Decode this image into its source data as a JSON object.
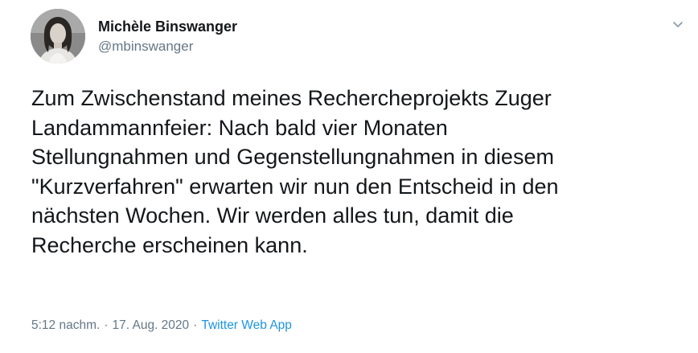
{
  "author": {
    "display_name": "Michèle Binswanger",
    "handle": "@mbinswanger",
    "avatar_icon": "profile-photo"
  },
  "tweet": {
    "lines": [
      "Zum Zwischenstand meines Rechercheprojekts Zuger",
      "Landammannfeier: Nach bald vier Monaten",
      "Stellungnahmen und Gegenstellungnahmen in diesem",
      "\"Kurzverfahren\" erwarten wir nun den Entscheid in den",
      "nächsten Wochen. Wir werden alles tun, damit die",
      "Recherche erscheinen kann."
    ]
  },
  "meta": {
    "time": "5:12 nachm.",
    "separator": "·",
    "date": "17. Aug. 2020",
    "source": "Twitter Web App"
  },
  "menu_icon": "chevron-down-icon",
  "colors": {
    "text": "#14171a",
    "secondary": "#657786",
    "link": "#1b95e0",
    "background": "#ffffff"
  }
}
